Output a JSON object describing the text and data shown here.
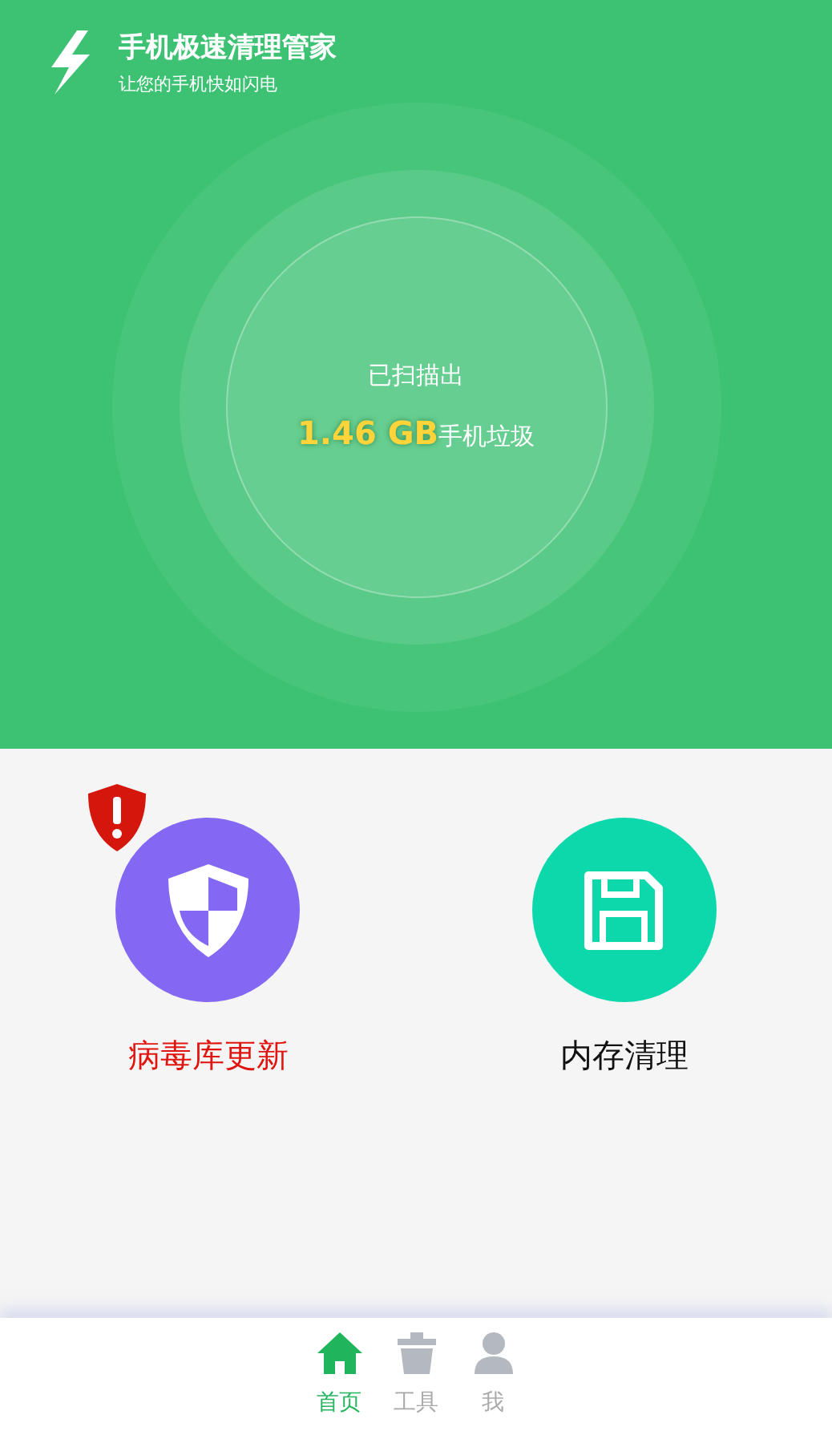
{
  "app": {
    "title": "手机极速清理管家",
    "subtitle": "让您的手机快如闪电"
  },
  "scan": {
    "caption": "已扫描出",
    "amount": "1.46 GB",
    "unit": "手机垃圾"
  },
  "features": [
    {
      "kind": "shield",
      "label": "病毒库更新",
      "alert": true,
      "color": "#8468f3"
    },
    {
      "kind": "disk",
      "label": "内存清理",
      "alert": false,
      "color": "#0cd8ac"
    }
  ],
  "tabs": [
    {
      "kind": "home",
      "label": "首页",
      "selected": true
    },
    {
      "kind": "tools",
      "label": "工具",
      "selected": false
    },
    {
      "kind": "user",
      "label": "我",
      "selected": false
    }
  ]
}
